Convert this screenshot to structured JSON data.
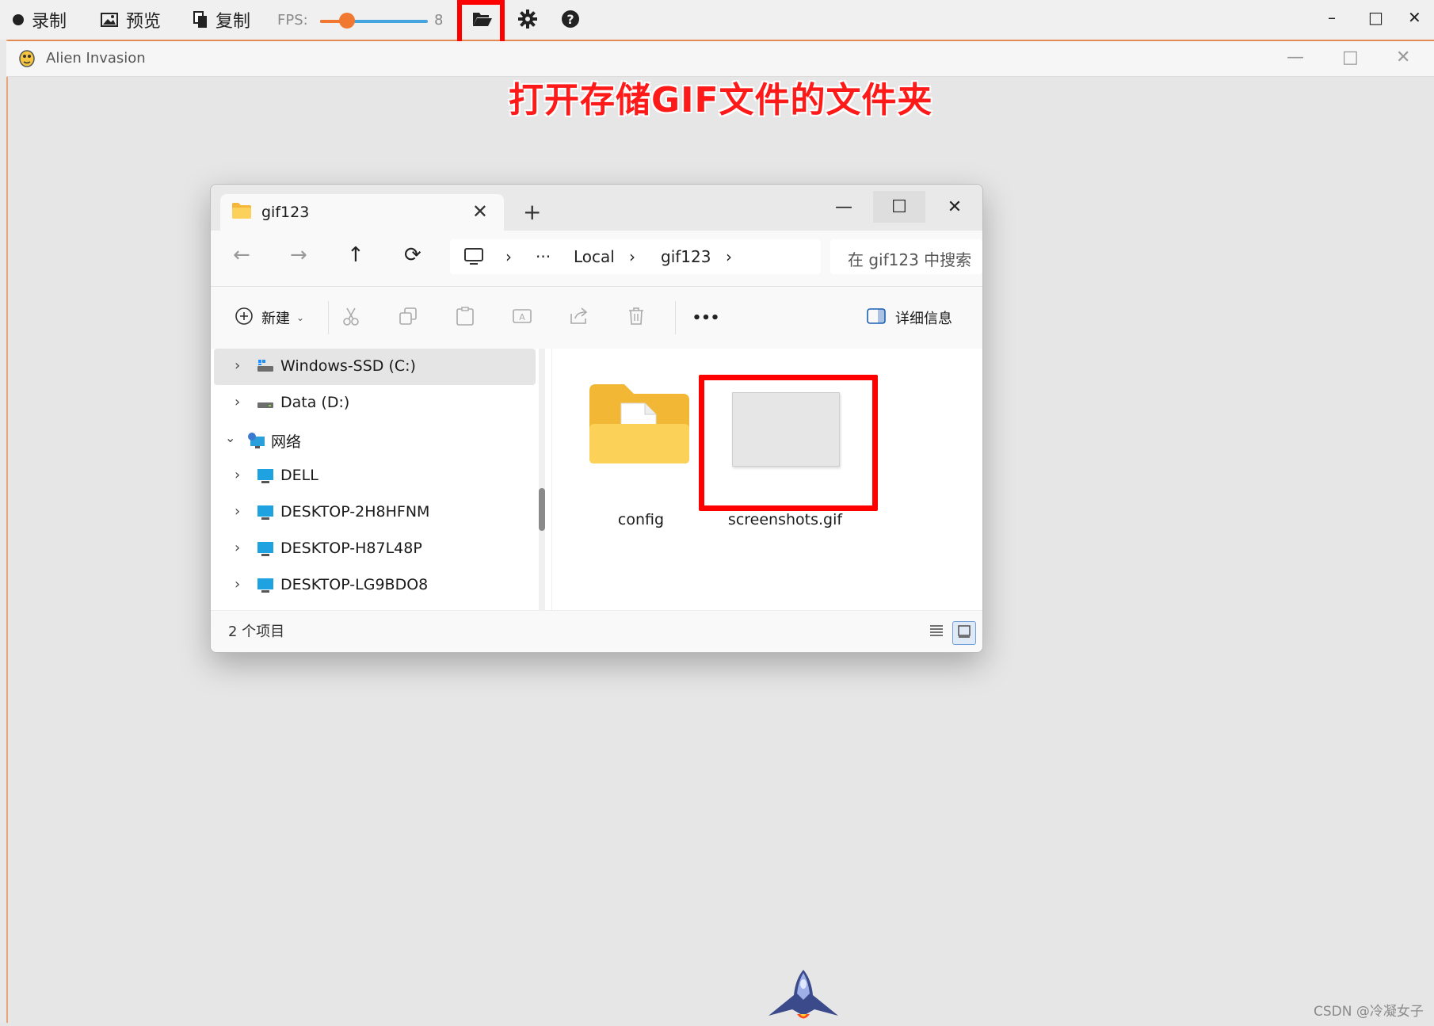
{
  "recorder": {
    "record_label": "录制",
    "preview_label": "预览",
    "copy_label": "复制",
    "fps_label": "FPS:",
    "fps_value": "8",
    "fps_fraction": 0.25,
    "icons": [
      "record-dot-icon",
      "image-icon",
      "copy-icon",
      "folder-open-icon",
      "gear-icon",
      "help-icon"
    ],
    "window_controls": [
      "–",
      "□",
      "✕"
    ]
  },
  "game_window": {
    "title": "Alien Invasion",
    "controls": [
      "—",
      "□",
      "✕"
    ]
  },
  "annotation": "打开存储GIF文件的文件夹",
  "explorer": {
    "tab_title": "gif123",
    "tab_close": "✕",
    "new_tab": "+",
    "window_controls": [
      "—",
      "☐",
      "✕"
    ],
    "breadcrumb": {
      "overflow": "···",
      "items": [
        "Local",
        "gif123"
      ]
    },
    "search_placeholder": "在 gif123 中搜索",
    "toolbar": {
      "new_label": "新建",
      "more_label": "•••",
      "details_label": "详细信息"
    },
    "nav_items": [
      {
        "label": "Windows-SSD (C:)",
        "selected": true
      },
      {
        "label": "Data (D:)"
      },
      {
        "label": "网络",
        "expanded": true
      },
      {
        "label": "DELL"
      },
      {
        "label": "DESKTOP-2H8HFNM"
      },
      {
        "label": "DESKTOP-H87L48P"
      },
      {
        "label": "DESKTOP-LG9BDO8"
      }
    ],
    "files": [
      {
        "name": "config",
        "type": "folder"
      },
      {
        "name": "screenshots.gif",
        "type": "gif"
      }
    ],
    "status": "2 个项目"
  },
  "colors": {
    "accent_red": "#ff0000",
    "slider_orange": "#f07830",
    "slider_blue": "#45a3e0",
    "frame_orange": "#e38a52"
  },
  "watermark": "CSDN @冷凝女子"
}
